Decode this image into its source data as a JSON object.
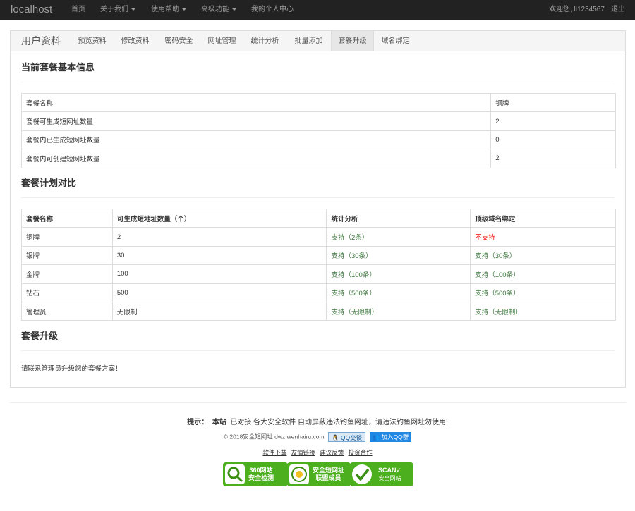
{
  "navbar": {
    "brand": "localhost",
    "items": [
      {
        "label": "首页"
      },
      {
        "label": "关于我们"
      },
      {
        "label": "使用帮助"
      },
      {
        "label": "高级功能"
      },
      {
        "label": "我的个人中心"
      }
    ],
    "welcome": "欢迎您, li1234567",
    "logout": "退出"
  },
  "tabs": {
    "title": "用户资料",
    "items": [
      {
        "label": "预览资料"
      },
      {
        "label": "修改资料"
      },
      {
        "label": "密码安全"
      },
      {
        "label": "网址管理"
      },
      {
        "label": "统计分析"
      },
      {
        "label": "批量添加"
      },
      {
        "label": "套餐升级",
        "active": true
      },
      {
        "label": "域名绑定"
      }
    ]
  },
  "basic": {
    "title": "当前套餐基本信息",
    "rows": [
      {
        "label": "套餐名称",
        "value": "铜牌"
      },
      {
        "label": "套餐可生成短网址数量",
        "value": "2"
      },
      {
        "label": "套餐内已生成短网址数量",
        "value": "0"
      },
      {
        "label": "套餐内可创建短网址数量",
        "value": "2"
      }
    ]
  },
  "compare": {
    "title": "套餐计划对比",
    "headers": [
      "套餐名称",
      "可生成短地址数量（个）",
      "统计分析",
      "顶级域名绑定"
    ],
    "rows": [
      [
        "铜牌",
        "2",
        "支持（2条）",
        "不支持"
      ],
      [
        "银牌",
        "30",
        "支持（30条）",
        "支持（30条）"
      ],
      [
        "金牌",
        "100",
        "支持（100条）",
        "支持（100条）"
      ],
      [
        "钻石",
        "500",
        "支持（500条）",
        "支持（500条）"
      ],
      [
        "管理员",
        "无限制",
        "支持（无限制）",
        "支持（无限制）"
      ]
    ]
  },
  "upgrade": {
    "title": "套餐升级",
    "note": "请联系管理员升级您的套餐方案！"
  },
  "footer": {
    "tip_label": "提示：",
    "tip_site": "本站",
    "tip_text": "已对接 各大安全软件 自动屏蔽违法钓鱼网址，请违法钓鱼网址勿使用!",
    "copyright": "© 2018安全短网址 dwz.wenhairu.com",
    "qq_talk": "QQ交谈",
    "qq_group": "加入QQ群",
    "links": [
      "软件下载",
      "友情链接",
      "建议反馈",
      "投资合作"
    ],
    "certs": [
      {
        "line1": "360网站",
        "line2": "安全检测"
      },
      {
        "line1": "安全短网址",
        "line2": "联盟成员"
      },
      {
        "line1": "SCAN✓",
        "line2": "安全网站"
      }
    ]
  },
  "colors": {
    "navbar": "#222222",
    "support_green": "#3c763d",
    "unsupported_red": "#ee0000",
    "cert_green": "#4caf1e"
  }
}
